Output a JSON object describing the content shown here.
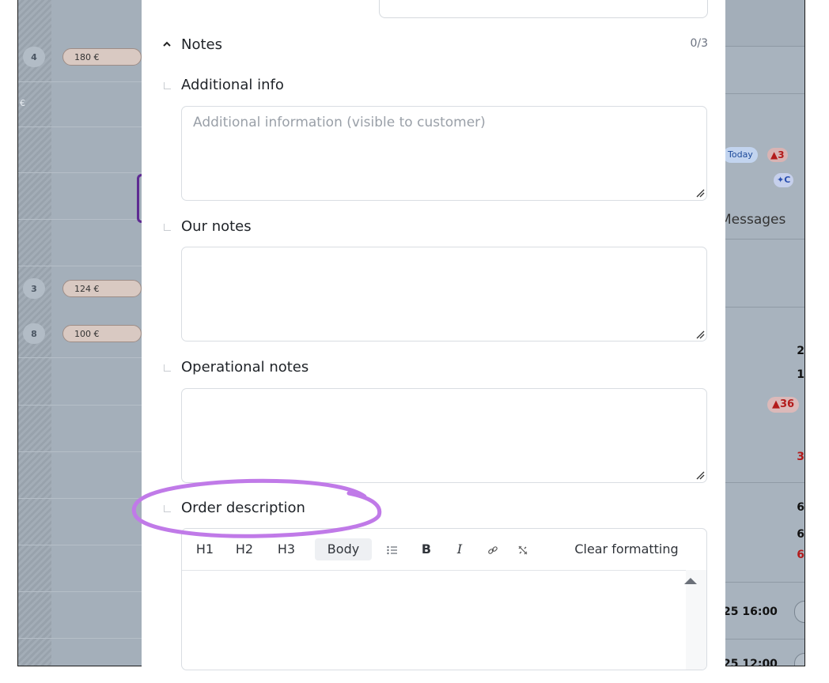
{
  "background": {
    "rows": [
      {
        "num": "4",
        "price": "180 €"
      },
      {
        "num": "3",
        "price": "124 €"
      },
      {
        "num": "8",
        "price": "100 €"
      }
    ],
    "left_fragment": "€",
    "right": {
      "today": "Today",
      "warn": "▲3",
      "c_chip": "✦C",
      "messages": "Messages",
      "nums": [
        "2",
        "1",
        "3",
        "6",
        "6",
        "6"
      ],
      "warn2": "▲36",
      "times": [
        "25 16:00",
        "25 12:00"
      ]
    }
  },
  "notes": {
    "title": "Notes",
    "count": "0/3",
    "collapse_icon": "chevron-up-icon",
    "additional_info": {
      "label": "Additional info",
      "placeholder": "Additional information (visible to customer)",
      "value": ""
    },
    "our_notes": {
      "label": "Our notes",
      "value": ""
    },
    "operational_notes": {
      "label": "Operational notes",
      "value": ""
    },
    "order_description": {
      "label": "Order description",
      "toolbar": {
        "h1": "H1",
        "h2": "H2",
        "h3": "H3",
        "body": "Body",
        "bullet_icon": "bullet-list-icon",
        "bold": "B",
        "italic": "I",
        "link_icon": "link-icon",
        "unlink_icon": "unlink-icon",
        "clear": "Clear formatting"
      },
      "content": ""
    }
  },
  "annotation_color": "#c07ae8"
}
